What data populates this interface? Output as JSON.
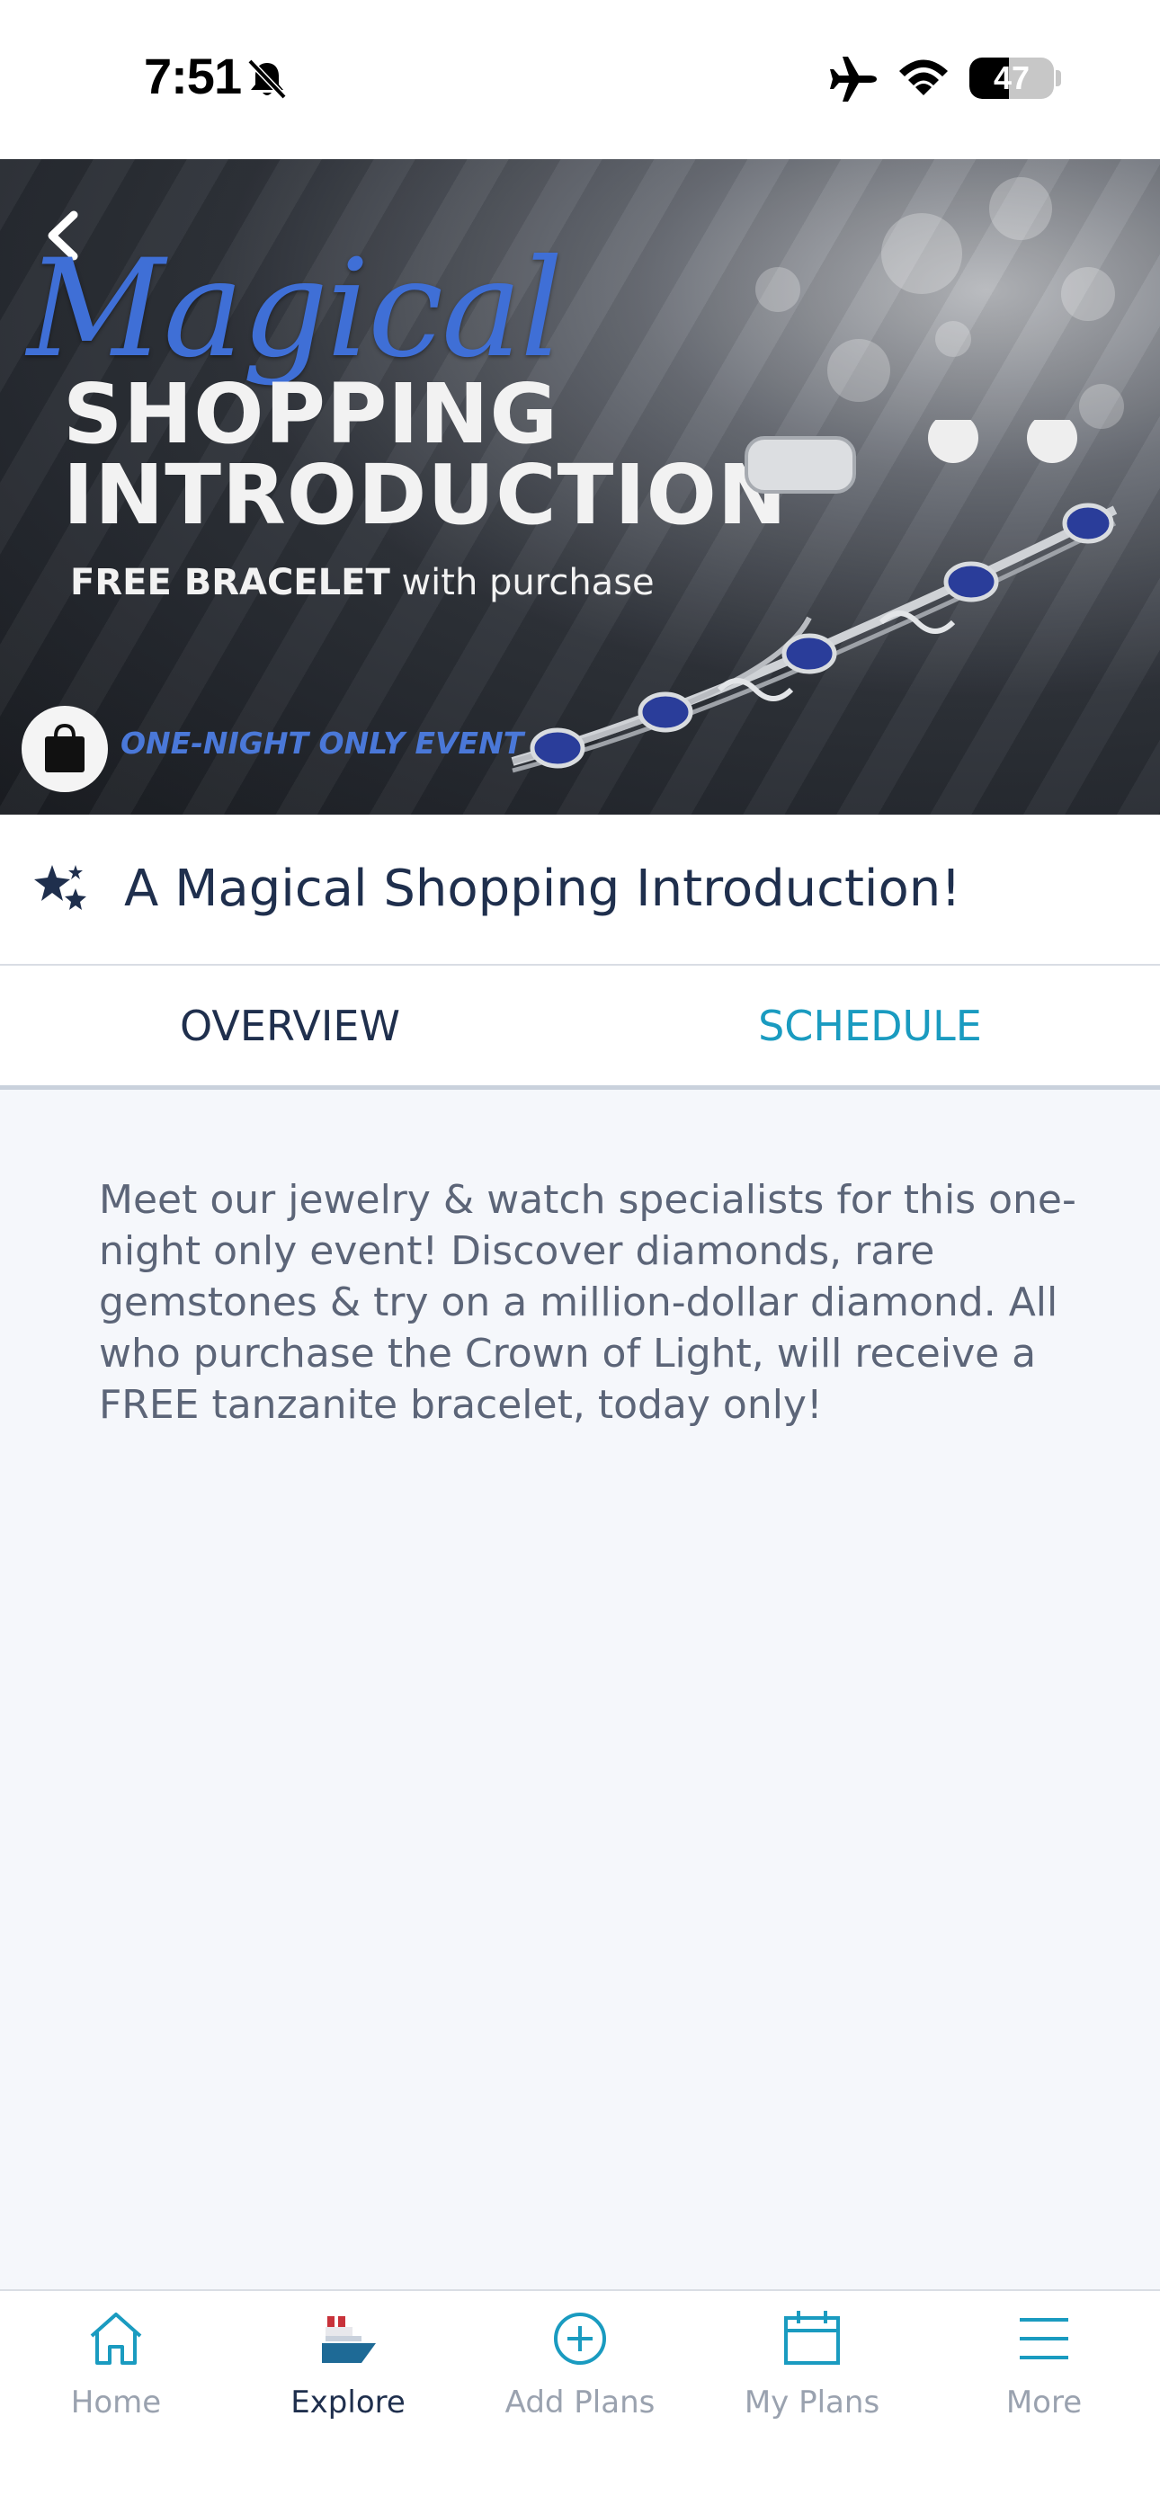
{
  "status_bar": {
    "time": "7:51",
    "battery_percent": 47,
    "battery_label": "47"
  },
  "hero": {
    "script_title": "Magical",
    "line1": "SHOPPING",
    "line2": "INTRODUCTION",
    "sub_bold": "FREE BRACELET",
    "sub_rest": " with purchase",
    "event_label": "ONE-NIGHT ONLY EVENT"
  },
  "event": {
    "title": "A Magical Shopping Introduction!"
  },
  "tabs": [
    {
      "label": "OVERVIEW",
      "active": true
    },
    {
      "label": "SCHEDULE",
      "active": false
    }
  ],
  "overview": {
    "description": "Meet our jewelry & watch specialists for this one-night only event! Discover diamonds, rare gemstones & try on a million-dollar diamond. All who purchase the Crown of Light, will receive a FREE tanzanite bracelet, today only!"
  },
  "bottom_nav": [
    {
      "label": "Home",
      "icon": "home-icon",
      "active": false
    },
    {
      "label": "Explore",
      "icon": "ship-icon",
      "active": true
    },
    {
      "label": "Add Plans",
      "icon": "plus-circle-icon",
      "active": false
    },
    {
      "label": "My Plans",
      "icon": "calendar-icon",
      "active": false
    },
    {
      "label": "More",
      "icon": "menu-icon",
      "active": false
    }
  ],
  "colors": {
    "accent": "#1a9bc0",
    "text_primary": "#1f2f4d",
    "text_muted": "#5c6578",
    "nav_inactive": "#9aa2af",
    "background": "#f5f7fb",
    "hero_blue": "#3f6fd6"
  }
}
